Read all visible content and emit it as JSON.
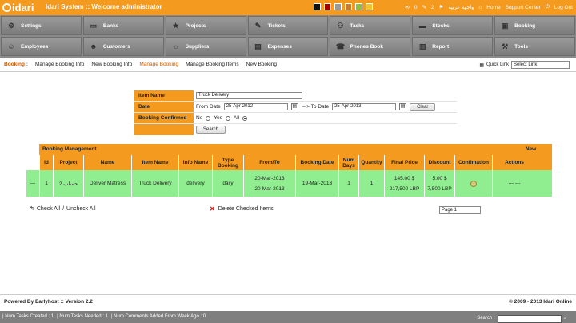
{
  "header": {
    "logo": "idari",
    "title": "Idari System :: Welcome administrator",
    "swatch_colors": [
      "#111111",
      "#a30000",
      "#9a9a9a",
      "#c97a2c",
      "#8fbf3c",
      "#f4c430"
    ],
    "messages_count": "0",
    "tasks_count": "2",
    "arabic_label": "واجهة عربية",
    "home": "Home",
    "support": "Support Center",
    "logout": "Log Out"
  },
  "nav": [
    {
      "label": "Settings",
      "icon": "gear-icon"
    },
    {
      "label": "Banks",
      "icon": "bank-icon"
    },
    {
      "label": "Projects",
      "icon": "star-icon"
    },
    {
      "label": "Tickets",
      "icon": "ticket-icon"
    },
    {
      "label": "Tasks",
      "icon": "tasks-icon"
    },
    {
      "label": "Stocks",
      "icon": "truck-icon"
    },
    {
      "label": "Booking",
      "icon": "book-icon"
    },
    {
      "label": "Employees",
      "icon": "people-icon"
    },
    {
      "label": "Customers",
      "icon": "customer-icon"
    },
    {
      "label": "Suppliers",
      "icon": "supplier-icon"
    },
    {
      "label": "Expenses",
      "icon": "briefcase-icon"
    },
    {
      "label": "Phones Book",
      "icon": "phone-icon"
    },
    {
      "label": "Report",
      "icon": "report-icon"
    },
    {
      "label": "Tools",
      "icon": "tools-icon"
    }
  ],
  "subnav": {
    "section": "Booking :",
    "links": [
      "Manage Booking Info",
      "New Booking Info",
      "Manage Booking",
      "Manage Booking Items",
      "New Booking"
    ],
    "quick_link_label": "Quick Link",
    "quick_link_value": "Select Link"
  },
  "filter": {
    "item_name_label": "Item Name",
    "item_name_value": "Truck Delivery",
    "date_label": "Date",
    "from_label": "From Date",
    "from_value": "25-Apr-2012",
    "to_label": "---> To Date",
    "to_value": "25-Apr-2013",
    "clear": "Clear",
    "confirmed_label": "Booking Confirmed",
    "opt_no": "No",
    "opt_yes": "Yes",
    "opt_all": "All",
    "search": "Search"
  },
  "table": {
    "title": "Booking Management",
    "new": "New",
    "columns": [
      "Id",
      "Project",
      "Name",
      "Item Name",
      "Info Name",
      "Type Booking",
      "From/To",
      "Booking Date",
      "Num Days",
      "Quantity",
      "Final Price",
      "Discount",
      "Confimation",
      "Actions"
    ],
    "row": {
      "dash": "---",
      "id": "1",
      "project": "2 حساب",
      "name": "Deliver Matress",
      "item": "Truck Delivery",
      "info": "delivery",
      "type": "daily",
      "from": "20-Mar-2013",
      "to": "20-Mar-2013",
      "booking_date": "19-Mar-2013",
      "days": "1",
      "qty": "1",
      "price_usd": "145.00 $",
      "price_lbp": "217,500 LBP",
      "disc_usd": "5.00 $",
      "disc_lbp": "7,500 LBP",
      "actions": "---   ---"
    }
  },
  "below": {
    "check_all": "Check All",
    "sep": "/",
    "uncheck_all": "Uncheck All",
    "delete": "Delete Checked Items",
    "page": "Page 1"
  },
  "footer": {
    "powered": "Powered By Earlyhost :: Version 2.2",
    "copyright": "© 2009 - 2013 Idari Online"
  },
  "statusbar": {
    "items": [
      "| Num Tasks Created : 1",
      "| Num Tasks Needed : 1",
      "| Num Comments Added From Week Ago : 0"
    ],
    "search": "Search :"
  }
}
